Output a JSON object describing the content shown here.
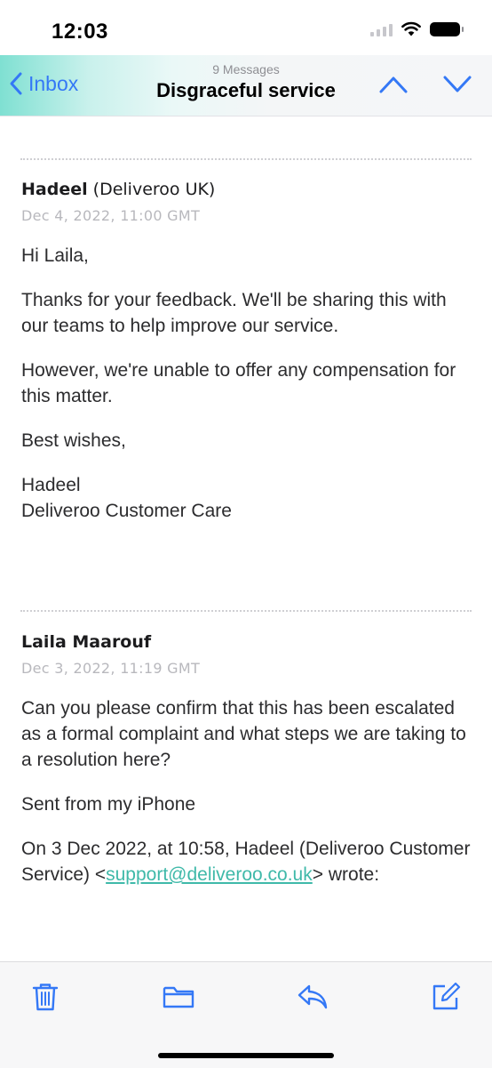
{
  "status_bar": {
    "time": "12:03"
  },
  "header": {
    "back_label": "Inbox",
    "message_count": "9 Messages",
    "subject": "Disgraceful service"
  },
  "messages": [
    {
      "sender_name": "Hadeel",
      "sender_org": "(Deliveroo UK)",
      "date": "Dec 4, 2022, 11:00 GMT",
      "paragraphs": [
        "Hi Laila,",
        "Thanks for your feedback. We'll be sharing this with our teams to help improve our service.",
        "However, we're unable to offer any compensation for this matter.",
        "Best wishes,"
      ],
      "signature_name": "Hadeel",
      "signature_team": "Deliveroo Customer Care"
    },
    {
      "sender_name": "Laila Maarouf",
      "date": "Dec 3, 2022, 11:19 GMT",
      "paragraphs": [
        "Can you please confirm that this has been escalated as a formal complaint and what steps we are taking to a resolution here?",
        "Sent from my iPhone"
      ],
      "quote_intro": "On 3 Dec 2022, at 10:58, Hadeel (Deliveroo Customer Service) <",
      "quote_email": "support@deliveroo.co.uk",
      "quote_end": ">",
      "quote_wrote": "wrote:"
    }
  ],
  "toolbar": {
    "icons": [
      "trash-icon",
      "folder-icon",
      "reply-icon",
      "compose-icon"
    ]
  },
  "colors": {
    "accent": "#3478f6",
    "link": "#3fb9a9",
    "header_gradient_start": "#7fe0d2"
  }
}
